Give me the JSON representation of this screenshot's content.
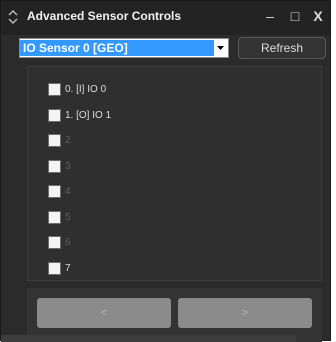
{
  "window": {
    "title": "Advanced Sensor Controls",
    "minimize_label": "–",
    "maximize_label": "□",
    "close_label": "X"
  },
  "sensor_select": {
    "selected": "IO Sensor 0 [GEO]"
  },
  "refresh_label": "Refresh",
  "io_items": [
    {
      "label": "0. [I] IO 0",
      "enabled": true
    },
    {
      "label": "1. [O] IO 1",
      "enabled": true
    },
    {
      "label": "2",
      "enabled": false
    },
    {
      "label": "3",
      "enabled": false
    },
    {
      "label": "4",
      "enabled": false
    },
    {
      "label": "5",
      "enabled": false
    },
    {
      "label": "6",
      "enabled": false
    },
    {
      "label": "7",
      "enabled": true
    }
  ],
  "nav": {
    "prev_label": "<",
    "next_label": ">"
  },
  "colors": {
    "window_bg": "#2b2b2b",
    "selection_blue": "#3399ff",
    "nav_button_disabled": "#8b8b8b"
  }
}
